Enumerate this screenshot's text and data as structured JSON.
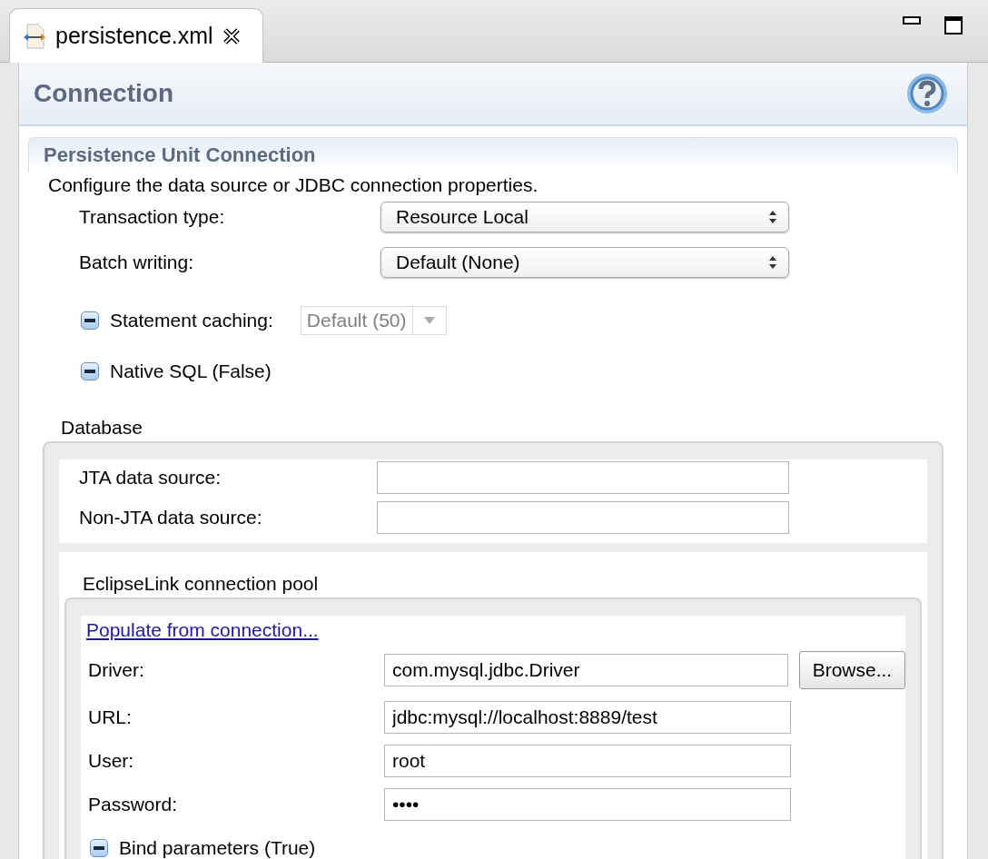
{
  "tab": {
    "title": "persistence.xml",
    "selected": true
  },
  "header": {
    "title": "Connection"
  },
  "section": {
    "title": "Persistence Unit Connection",
    "description": "Configure the data source or JDBC connection properties.",
    "combos": [
      {
        "label": "Transaction type:",
        "value": "Resource Local"
      },
      {
        "label": "Batch writing:",
        "value": "Default (None)"
      }
    ],
    "statement_caching": {
      "label": "Statement caching:",
      "indeterminate": true,
      "value": "Default (50)",
      "disabled": true
    },
    "native_sql": {
      "label": "Native SQL (False)",
      "indeterminate": true
    }
  },
  "database": {
    "title": "Database",
    "fields": [
      {
        "label": "JTA data source:"
      },
      {
        "label": "Non-JTA data source:"
      }
    ],
    "pool": {
      "title": "EclipseLink connection pool",
      "link": "Populate from connection...",
      "fields": [
        {
          "label": "Driver:",
          "value": "com.mysql.jdbc.Driver",
          "kind": "browse",
          "button": "Browse..."
        },
        {
          "label": "URL:",
          "value": "jdbc:mysql://localhost:8889/test",
          "kind": "text"
        },
        {
          "label": "User:",
          "value": "root",
          "kind": "text"
        },
        {
          "label": "Password:",
          "value": "••••",
          "kind": "text"
        }
      ],
      "bind_parameters": {
        "label": "Bind parameters (True)",
        "indeterminate": true
      }
    }
  }
}
